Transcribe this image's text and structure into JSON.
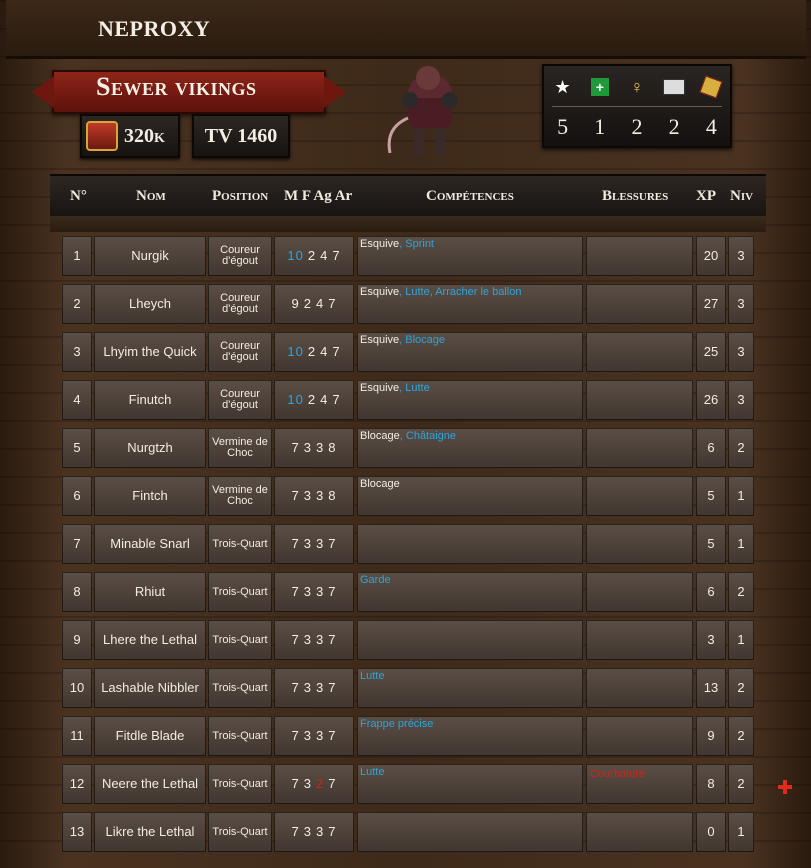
{
  "coach_name": "NEPROXY",
  "team": {
    "name": "Sewer vikings",
    "money": "320k",
    "tv": "TV 1460"
  },
  "resources": [
    {
      "icon": "star-icon",
      "value": "5"
    },
    {
      "icon": "apothecary-icon",
      "value": "1"
    },
    {
      "icon": "cheerleader-icon",
      "value": "2"
    },
    {
      "icon": "assistant-coach-icon",
      "value": "2"
    },
    {
      "icon": "reroll-icon",
      "value": "4"
    }
  ],
  "columns": {
    "num": "N°",
    "name": "Nom",
    "position": "Position",
    "stats": "M F Ag Ar",
    "skills": "Compétences",
    "injuries": "Blessures",
    "xp": "XP",
    "level": "Niv"
  },
  "players": [
    {
      "num": "1",
      "name": "Nurgik",
      "position": "Coureur d'égout",
      "stats": [
        {
          "v": "10",
          "c": "blue"
        },
        {
          "v": "2"
        },
        {
          "v": "4"
        },
        {
          "v": "7"
        }
      ],
      "skills": [
        {
          "t": "Esquive",
          "c": "white"
        },
        {
          "t": ", Sprint",
          "c": "blue"
        }
      ],
      "injury": "",
      "xp": "20",
      "level": "3"
    },
    {
      "num": "2",
      "name": "Lheych",
      "position": "Coureur d'égout",
      "stats": [
        {
          "v": "9"
        },
        {
          "v": "2"
        },
        {
          "v": "4"
        },
        {
          "v": "7"
        }
      ],
      "skills": [
        {
          "t": "Esquive",
          "c": "white"
        },
        {
          "t": ", Lutte, Arracher le ballon",
          "c": "blue"
        }
      ],
      "injury": "",
      "xp": "27",
      "level": "3"
    },
    {
      "num": "3",
      "name": "Lhyim the Quick",
      "position": "Coureur d'égout",
      "stats": [
        {
          "v": "10",
          "c": "blue"
        },
        {
          "v": "2"
        },
        {
          "v": "4"
        },
        {
          "v": "7"
        }
      ],
      "skills": [
        {
          "t": "Esquive",
          "c": "white"
        },
        {
          "t": ", Blocage",
          "c": "blue"
        }
      ],
      "injury": "",
      "xp": "25",
      "level": "3"
    },
    {
      "num": "4",
      "name": "Finutch",
      "position": "Coureur d'égout",
      "stats": [
        {
          "v": "10",
          "c": "blue"
        },
        {
          "v": "2"
        },
        {
          "v": "4"
        },
        {
          "v": "7"
        }
      ],
      "skills": [
        {
          "t": "Esquive",
          "c": "white"
        },
        {
          "t": ", Lutte",
          "c": "blue"
        }
      ],
      "injury": "",
      "xp": "26",
      "level": "3"
    },
    {
      "num": "5",
      "name": "Nurgtzh",
      "position": "Vermine de Choc",
      "stats": [
        {
          "v": "7"
        },
        {
          "v": "3"
        },
        {
          "v": "3"
        },
        {
          "v": "8"
        }
      ],
      "skills": [
        {
          "t": "Blocage",
          "c": "white"
        },
        {
          "t": ", Châtaigne",
          "c": "blue"
        }
      ],
      "injury": "",
      "xp": "6",
      "level": "2"
    },
    {
      "num": "6",
      "name": "Fintch",
      "position": "Vermine de Choc",
      "stats": [
        {
          "v": "7"
        },
        {
          "v": "3"
        },
        {
          "v": "3"
        },
        {
          "v": "8"
        }
      ],
      "skills": [
        {
          "t": "Blocage",
          "c": "white"
        }
      ],
      "injury": "",
      "xp": "5",
      "level": "1"
    },
    {
      "num": "7",
      "name": "Minable Snarl",
      "position": "Trois-Quart",
      "stats": [
        {
          "v": "7"
        },
        {
          "v": "3"
        },
        {
          "v": "3"
        },
        {
          "v": "7"
        }
      ],
      "skills": [],
      "injury": "",
      "xp": "5",
      "level": "1"
    },
    {
      "num": "8",
      "name": "Rhiut",
      "position": "Trois-Quart",
      "stats": [
        {
          "v": "7"
        },
        {
          "v": "3"
        },
        {
          "v": "3"
        },
        {
          "v": "7"
        }
      ],
      "skills": [
        {
          "t": "Garde",
          "c": "blue"
        }
      ],
      "injury": "",
      "xp": "6",
      "level": "2"
    },
    {
      "num": "9",
      "name": "Lhere the Lethal",
      "position": "Trois-Quart",
      "stats": [
        {
          "v": "7"
        },
        {
          "v": "3"
        },
        {
          "v": "3"
        },
        {
          "v": "7"
        }
      ],
      "skills": [],
      "injury": "",
      "xp": "3",
      "level": "1"
    },
    {
      "num": "10",
      "name": "Lashable Nibbler",
      "position": "Trois-Quart",
      "stats": [
        {
          "v": "7"
        },
        {
          "v": "3"
        },
        {
          "v": "3"
        },
        {
          "v": "7"
        }
      ],
      "skills": [
        {
          "t": "Lutte",
          "c": "blue"
        }
      ],
      "injury": "",
      "xp": "13",
      "level": "2"
    },
    {
      "num": "11",
      "name": "Fitdle Blade",
      "position": "Trois-Quart",
      "stats": [
        {
          "v": "7"
        },
        {
          "v": "3"
        },
        {
          "v": "3"
        },
        {
          "v": "7"
        }
      ],
      "skills": [
        {
          "t": "Frappe précise",
          "c": "blue"
        }
      ],
      "injury": "",
      "xp": "9",
      "level": "2"
    },
    {
      "num": "12",
      "name": "Neere the Lethal",
      "position": "Trois-Quart",
      "stats": [
        {
          "v": "7"
        },
        {
          "v": "3"
        },
        {
          "v": "2",
          "c": "red"
        },
        {
          "v": "7"
        }
      ],
      "skills": [
        {
          "t": "Lutte",
          "c": "blue"
        }
      ],
      "injury": "Courbaturé",
      "xp": "8",
      "level": "2"
    },
    {
      "num": "13",
      "name": "Likre the Lethal",
      "position": "Trois-Quart",
      "stats": [
        {
          "v": "7"
        },
        {
          "v": "3"
        },
        {
          "v": "3"
        },
        {
          "v": "7"
        }
      ],
      "skills": [],
      "injury": "",
      "xp": "0",
      "level": "1"
    }
  ]
}
